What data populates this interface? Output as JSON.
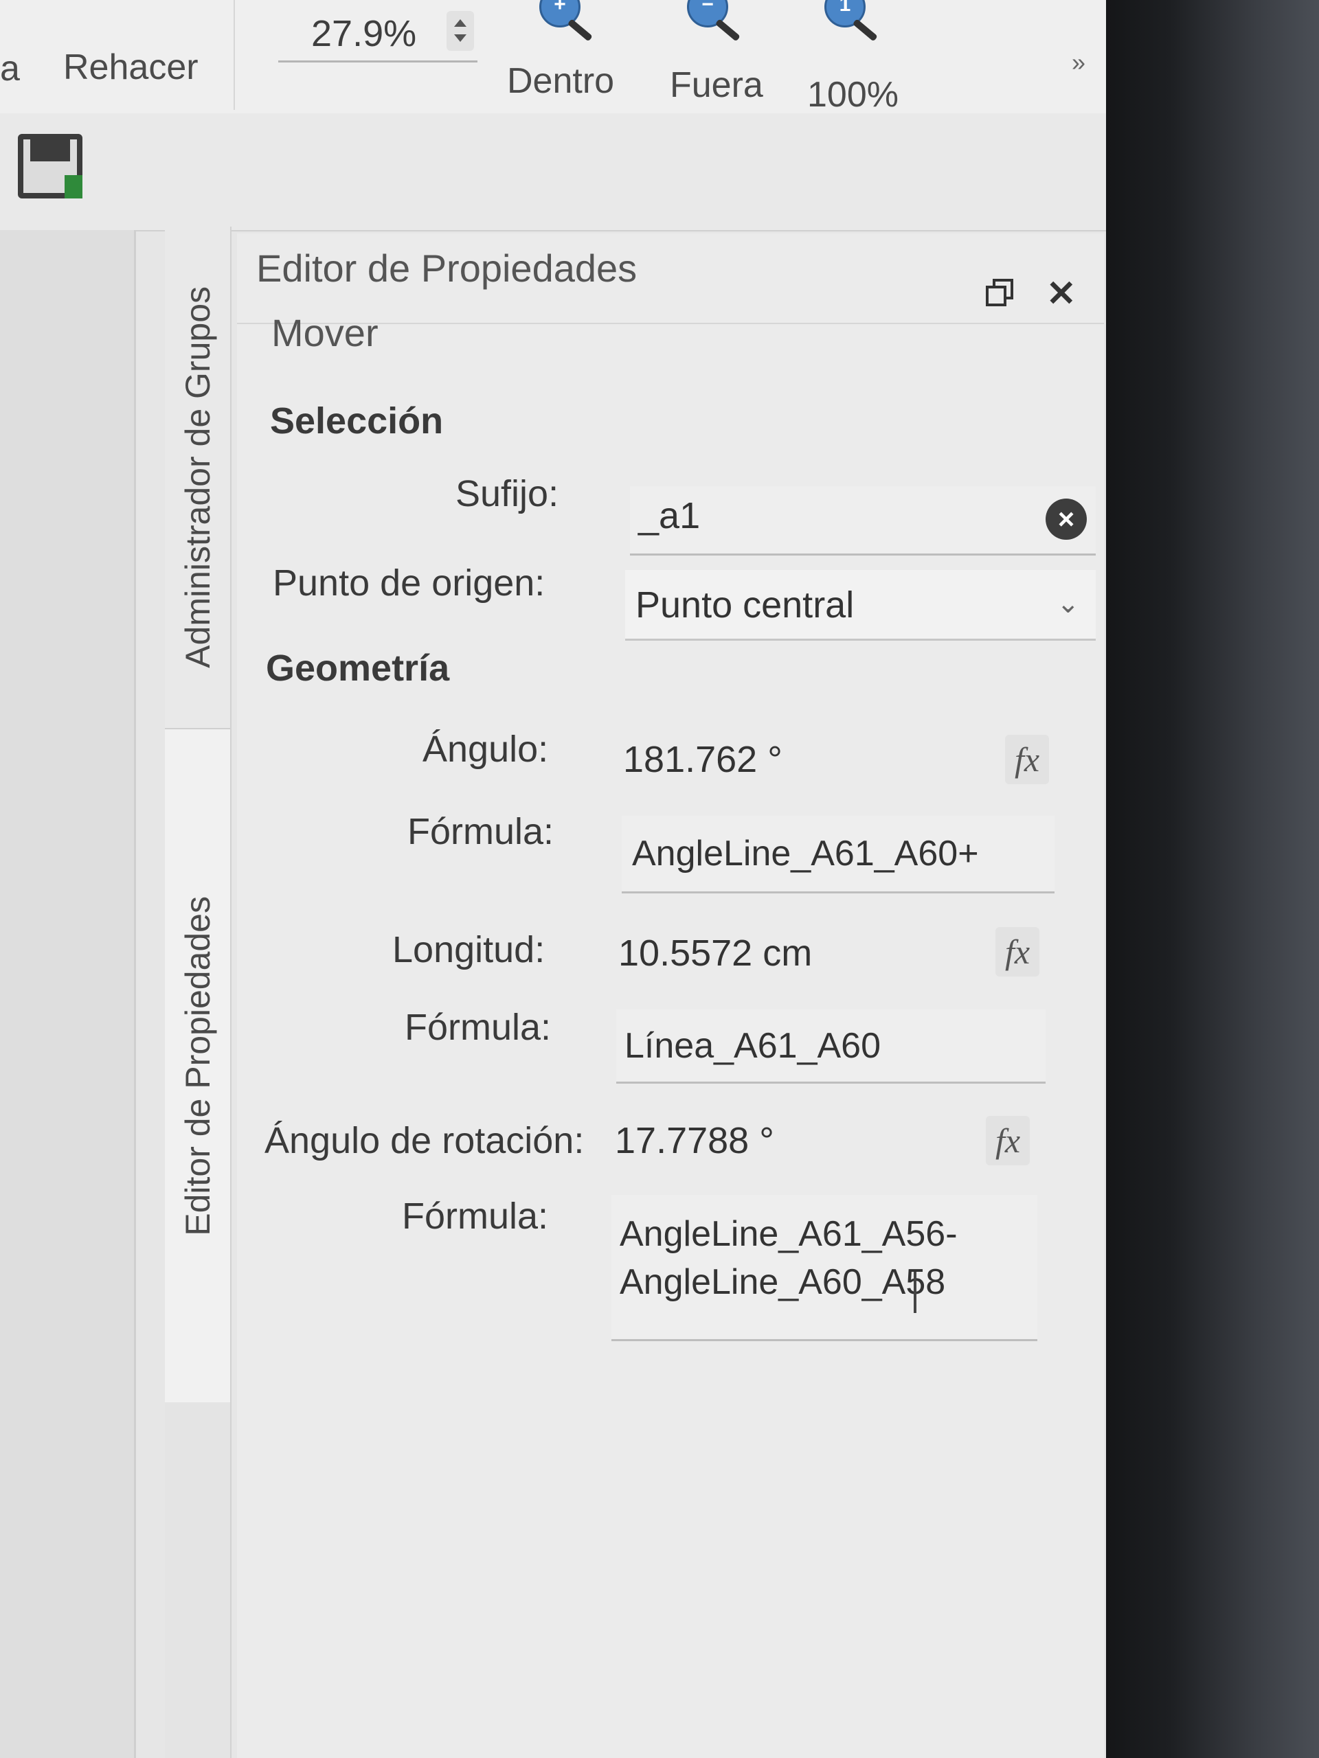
{
  "toolbar": {
    "partial_left": "a",
    "redo_label": "Rehacer",
    "zoom_value": "27.9%",
    "zoom_in_label": "Dentro",
    "zoom_out_label": "Fuera",
    "zoom_100_label": "100%",
    "overflow": "»"
  },
  "side_tabs": {
    "groups_manager": "Administrador de Grupos",
    "property_editor": "Editor de Propiedades"
  },
  "panel": {
    "title": "Editor de Propiedades",
    "operation": "Mover",
    "close_glyph": "✕",
    "selection": {
      "heading": "Selección",
      "suffix_label": "Sufijo:",
      "suffix_value": "_a1",
      "origin_label": "Punto de origen:",
      "origin_value": "Punto central"
    },
    "geometry": {
      "heading": "Geometría",
      "angle_label": "Ángulo:",
      "angle_value": "181.762 °",
      "angle_formula_label": "Fórmula:",
      "angle_formula": "AngleLine_A61_A60+",
      "length_label": "Longitud:",
      "length_value": "10.5572 cm",
      "length_formula_label": "Fórmula:",
      "length_formula": "Línea_A61_A60",
      "rotation_label": "Ángulo de rotación:",
      "rotation_value": "17.7788 °",
      "rotation_formula_label": "Fórmula:",
      "rotation_formula_line1": "AngleLine_A61_A56-",
      "rotation_formula_line2": "AngleLine_A60_A58"
    },
    "fx_glyph": "fx"
  }
}
